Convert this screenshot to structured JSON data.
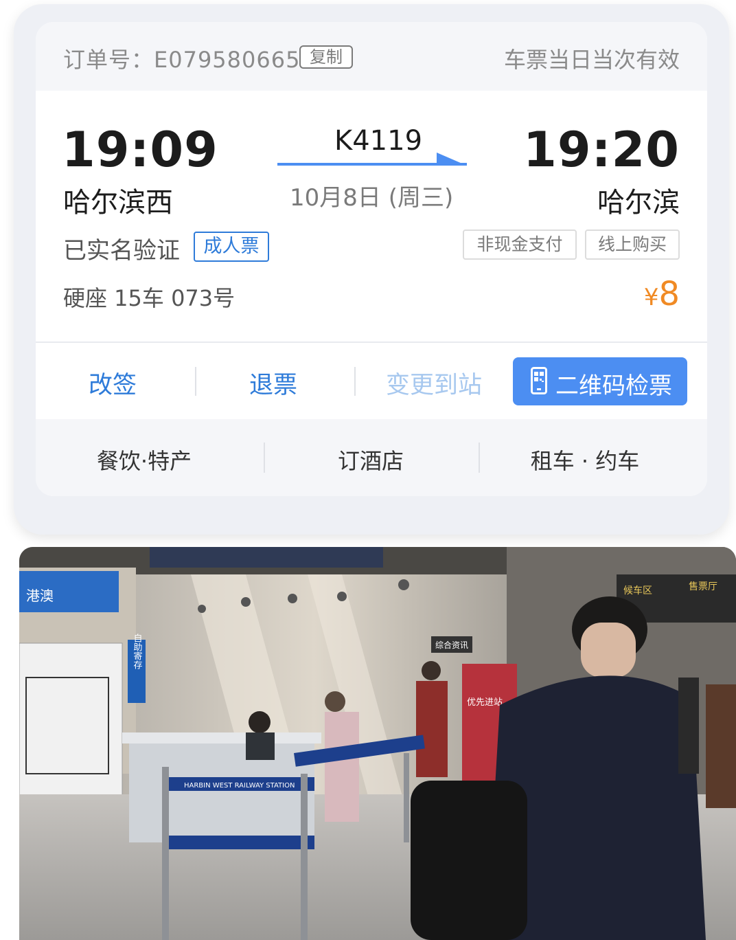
{
  "order": {
    "label": "订单号：E079580665",
    "copy_label": "复制",
    "validity_note": "车票当日当次有效"
  },
  "trip": {
    "departure_time": "19:09",
    "departure_station": "哈尔滨西",
    "train_number": "K4119",
    "date": "10月8日 (周三)",
    "arrival_time": "19:20",
    "arrival_station": "哈尔滨"
  },
  "passenger": {
    "verification": "已实名验证",
    "ticket_type": "成人票",
    "payment_tag": "非现金支付",
    "purchase_tag": "线上购买",
    "seat": "硬座 15车 073号",
    "currency": "¥",
    "price": "8"
  },
  "actions": {
    "change": "改签",
    "refund": "退票",
    "change_station": "变更到站",
    "qr_check": "二维码检票"
  },
  "services": {
    "food": "餐饮·特产",
    "hotel": "订酒店",
    "car": "租车 · 约车"
  },
  "photo": {
    "billboard": "港澳",
    "locker_sign": "自助寄存",
    "info_sign": "综合资讯",
    "waiting_sign": "候车区",
    "ticket_hall_sign": "售票厅",
    "priority_sign": "优先进站",
    "barrier_tape": "HARBIN WEST RAILWAY STATION"
  },
  "colors": {
    "accent_blue": "#2e7bd9",
    "button_blue": "#4c8ef2",
    "price_orange": "#f08a24",
    "disabled_blue": "#a7c8ef"
  }
}
